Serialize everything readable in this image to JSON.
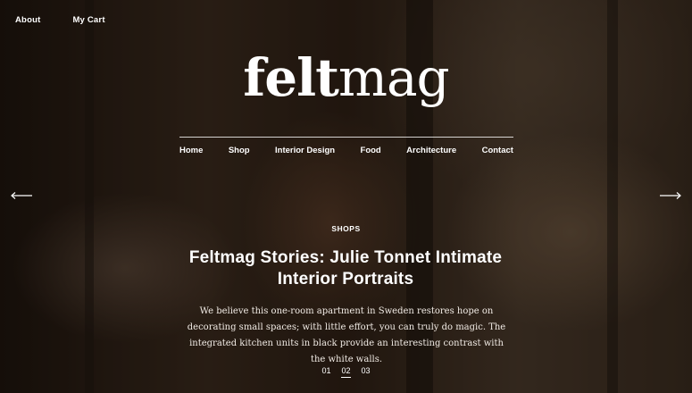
{
  "header": {
    "links": [
      {
        "label": "About"
      },
      {
        "label": "My Cart"
      }
    ]
  },
  "logo": {
    "bold_part": "felt",
    "light_part": "mag"
  },
  "nav": {
    "items": [
      {
        "label": "Home"
      },
      {
        "label": "Shop"
      },
      {
        "label": "Interior Design"
      },
      {
        "label": "Food"
      },
      {
        "label": "Architecture"
      },
      {
        "label": "Contact"
      }
    ]
  },
  "hero": {
    "category": "SHOPS",
    "title": "Feltmag Stories: Julie Tonnet Intimate Interior Portraits",
    "excerpt": "We believe this one-room apartment in Sweden restores hope on decorating small spaces; with little effort, you can truly do magic. The integrated kitchen units in black provide an interesting contrast with the white walls."
  },
  "slider": {
    "prev_icon": "arrow-left-icon",
    "next_icon": "arrow-right-icon",
    "pages": [
      {
        "label": "01",
        "active": false
      },
      {
        "label": "02",
        "active": true
      },
      {
        "label": "03",
        "active": false
      }
    ]
  },
  "colors": {
    "text": "#ffffff",
    "overlay": "#1c130d"
  }
}
